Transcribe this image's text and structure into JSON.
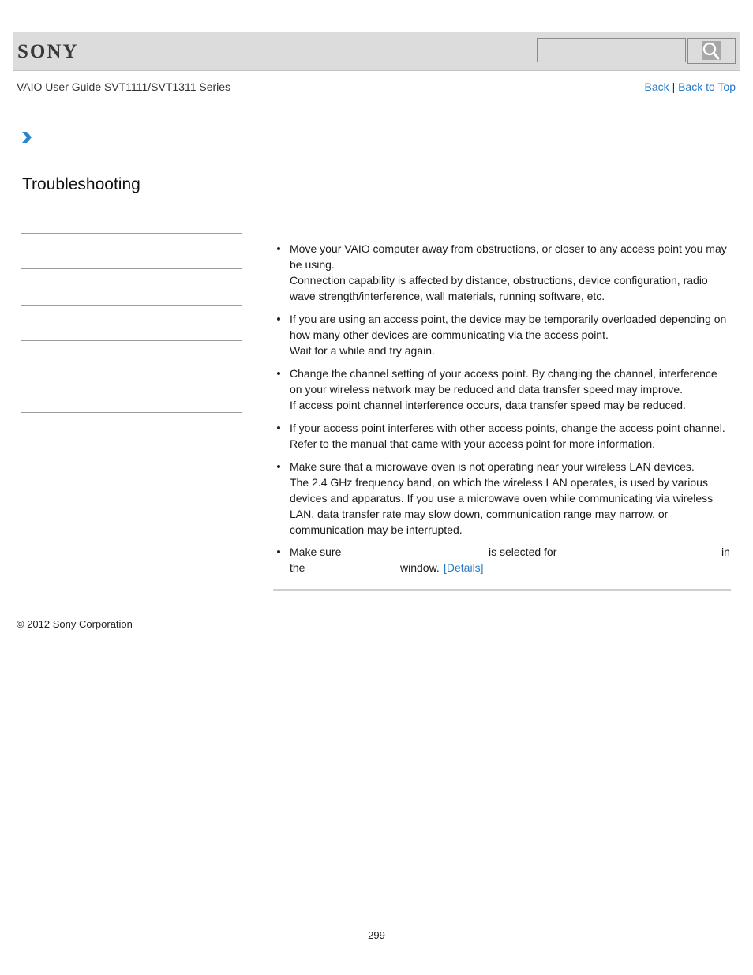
{
  "header": {
    "logo": "SONY",
    "search": {
      "value": "",
      "placeholder": ""
    },
    "search_button_icon": "magnifier-icon"
  },
  "subheader": {
    "guide_title": "VAIO User Guide SVT1111/SVT1311 Series",
    "links": [
      {
        "label": "Back"
      },
      {
        "separator": "|"
      },
      {
        "label": "Back to Top"
      }
    ]
  },
  "breadcrumb": {
    "icon": "chevron-right-icon"
  },
  "sidebar": {
    "title": "Troubleshooting",
    "items": [
      {
        "label": ""
      },
      {
        "label": ""
      },
      {
        "label": ""
      },
      {
        "label": ""
      },
      {
        "label": ""
      },
      {
        "label": ""
      }
    ]
  },
  "content": {
    "bullets": [
      {
        "lines": [
          "Move your VAIO computer away from obstructions, or closer to any access point you may be using.",
          "Connection capability is affected by distance, obstructions, device configuration, radio wave strength/interference, wall materials, running software, etc."
        ]
      },
      {
        "lines": [
          "If you are using an access point, the device may be temporarily overloaded depending on how many other devices are communicating via the access point.",
          "Wait for a while and try again."
        ]
      },
      {
        "lines": [
          "Change the channel setting of your access point. By changing the channel, interference on your wireless network may be reduced and data transfer speed may improve.",
          "If access point channel interference occurs, data transfer speed may be reduced."
        ]
      },
      {
        "lines": [
          "If your access point interferes with other access points, change the access point channel.",
          "Refer to the manual that came with your access point for more information."
        ]
      },
      {
        "lines": [
          "Make sure that a microwave oven is not operating near your wireless LAN devices.",
          "The 2.4 GHz frequency band, on which the wireless LAN operates, is used by various devices and apparatus. If you use a microwave oven while communicating via wireless LAN, data transfer rate may slow down, communication range may narrow, or communication may be interrupted."
        ]
      }
    ],
    "last_bullet": {
      "frag_make_sure": "Make sure",
      "frag_is_selected_for": "is selected for",
      "frag_in": "in",
      "frag_the": "the",
      "frag_window": "window.",
      "details_link": "[Details]"
    }
  },
  "footer": {
    "copyright": "© 2012 Sony Corporation",
    "page_number": "299"
  },
  "colors": {
    "link": "#2a7bc4",
    "header_bg": "#dcdcdc",
    "chevron": "#2a86c9"
  }
}
